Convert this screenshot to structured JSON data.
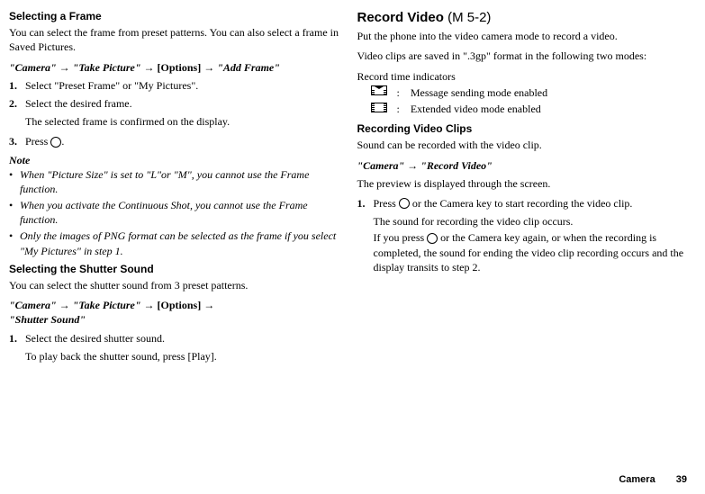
{
  "left": {
    "selectFrame": {
      "heading": "Selecting a Frame",
      "intro": "You can select the frame from preset patterns. You can also select a frame in Saved Pictures.",
      "path1": "\"Camera\"",
      "path2": "\"Take Picture\"",
      "path3": "[Options]",
      "path4": "\"Add Frame\"",
      "step1": "Select \"Preset Frame\" or \"My Pictures\".",
      "step2": "Select the desired frame.",
      "step2detail": "The selected frame is confirmed on the display.",
      "step3a": "Press ",
      "step3b": "."
    },
    "note": {
      "label": "Note",
      "item1": "When \"Picture Size\" is set to \"L\"or \"M\", you cannot use the Frame function.",
      "item2": "When you activate the Continuous Shot, you cannot use the Frame function.",
      "item3": "Only the images of PNG format can be selected as the frame if you select \"My Pictures\" in step 1."
    },
    "shutter": {
      "heading": "Selecting the Shutter Sound",
      "intro": "You can select the shutter sound from 3 preset patterns.",
      "path1": "\"Camera\"",
      "path2": "\"Take Picture\"",
      "path3": "[Options]",
      "path4": "\"Shutter Sound\"",
      "step1": "Select the desired shutter sound.",
      "step1detail": "To play back the shutter sound, press [Play]."
    }
  },
  "right": {
    "record": {
      "headingbase": "Record Video",
      "headingcode": " (M 5-2)",
      "intro": "Put the phone into the video camera mode to record a video.",
      "saved": "Video clips are saved in \".3gp\" format in the following two modes:",
      "indicatorsLabel": "Record time indicators",
      "ind1": "Message sending mode enabled",
      "ind2": "Extended video mode enabled"
    },
    "clips": {
      "heading": "Recording Video Clips",
      "intro": "Sound can be recorded with the video clip.",
      "path1": "\"Camera\"",
      "path2": "\"Record Video\"",
      "preview": "The preview is displayed through the screen.",
      "step1a": "Press ",
      "step1b": " or the Camera key to start recording the video clip.",
      "step1d1": "The sound for recording the video clip occurs.",
      "step1d2a": "If you press ",
      "step1d2b": " or the Camera key again, or when the recording is completed, the sound for ending the video clip recording occurs and the display transits to step 2."
    }
  },
  "arrow": "→",
  "footer": {
    "label": "Camera",
    "page": "39"
  }
}
